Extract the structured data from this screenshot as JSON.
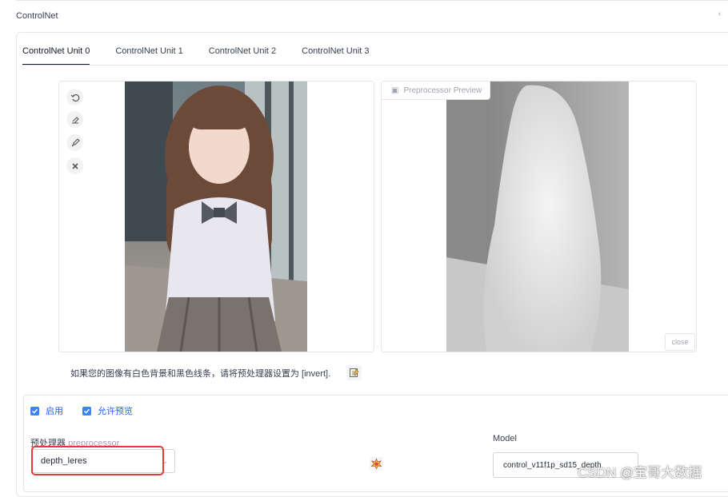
{
  "section": {
    "title": "ControlNet",
    "collapse_icon": "chevron-icon"
  },
  "tabs": [
    {
      "label": "ControlNet Unit 0",
      "active": true
    },
    {
      "label": "ControlNet Unit 1",
      "active": false
    },
    {
      "label": "ControlNet Unit 2",
      "active": false
    },
    {
      "label": "ControlNet Unit 3",
      "active": false
    }
  ],
  "image_tools": [
    "undo-icon",
    "eraser-icon",
    "brush-icon",
    "clear-icon"
  ],
  "preview": {
    "label": "Preprocessor Preview",
    "close_label": "close"
  },
  "hint": {
    "text": "如果您的图像有白色背景和黑色线条，请将预处理器设置为 [invert]."
  },
  "checkboxes": [
    {
      "label": "启用",
      "checked": true
    },
    {
      "label": "允许预览",
      "checked": true
    }
  ],
  "preprocessor": {
    "label_cn": "预处理器",
    "label_en": "preprocessor",
    "value": "depth_leres"
  },
  "model": {
    "label": "Model",
    "value": "control_v11f1p_sd15_depth"
  },
  "watermark": "CSDN @宝哥大数据",
  "colors": {
    "accent": "#3b82f6",
    "highlight": "#e53935"
  }
}
